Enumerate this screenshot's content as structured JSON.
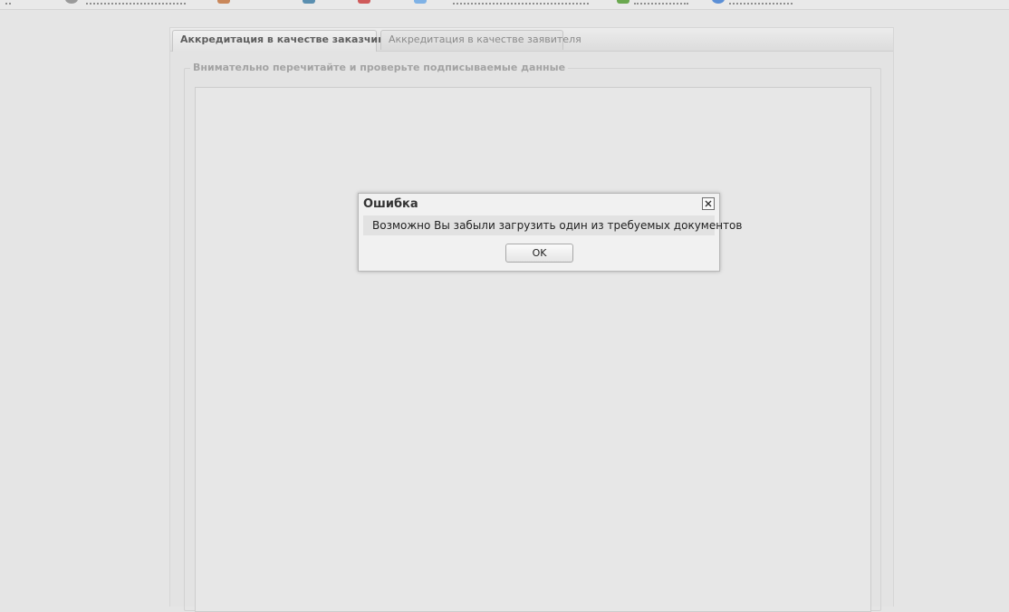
{
  "tabs": [
    {
      "label": "Аккредитация в качестве заказчика",
      "active": true
    },
    {
      "label": "Аккредитация в качестве заявителя",
      "active": false
    }
  ],
  "form": {
    "legend": "Внимательно перечитайте и проверьте подписываемые данные"
  },
  "dialog": {
    "title": "Ошибка",
    "message": "Возможно Вы забыли загрузить один из требуемых документов",
    "ok_label": "OK",
    "close_icon": "close-icon"
  },
  "toolbar_icons": [
    "gear-icon",
    "edit-icon",
    "monitor-icon",
    "document-icon",
    "info-icon",
    "table-icon",
    "user-icon"
  ]
}
